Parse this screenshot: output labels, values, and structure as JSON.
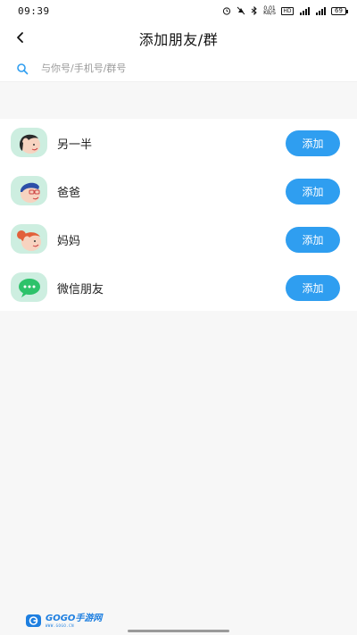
{
  "status_bar": {
    "time": "09:39",
    "net_speed": "0.01",
    "net_unit": "KB/S",
    "hd_label": "HD",
    "signal_1": "4G",
    "signal_2": "4G",
    "battery": "69"
  },
  "header": {
    "title": "添加朋友/群"
  },
  "search": {
    "placeholder": "与你号/手机号/群号",
    "value": ""
  },
  "contacts": [
    {
      "name": "另一半",
      "button_label": "添加",
      "avatar": "woman-face-avatar"
    },
    {
      "name": "爸爸",
      "button_label": "添加",
      "avatar": "man-glasses-avatar"
    },
    {
      "name": "妈妈",
      "button_label": "添加",
      "avatar": "woman-bun-avatar"
    },
    {
      "name": "微信朋友",
      "button_label": "添加",
      "avatar": "wechat-icon"
    }
  ],
  "watermark": {
    "main": "GOGO手游网",
    "sub": "WWW.GOGO.CN"
  },
  "colors": {
    "accent": "#2f9ef0",
    "page_background": "#f7f7f7",
    "wechat_green": "#2dc26a"
  }
}
